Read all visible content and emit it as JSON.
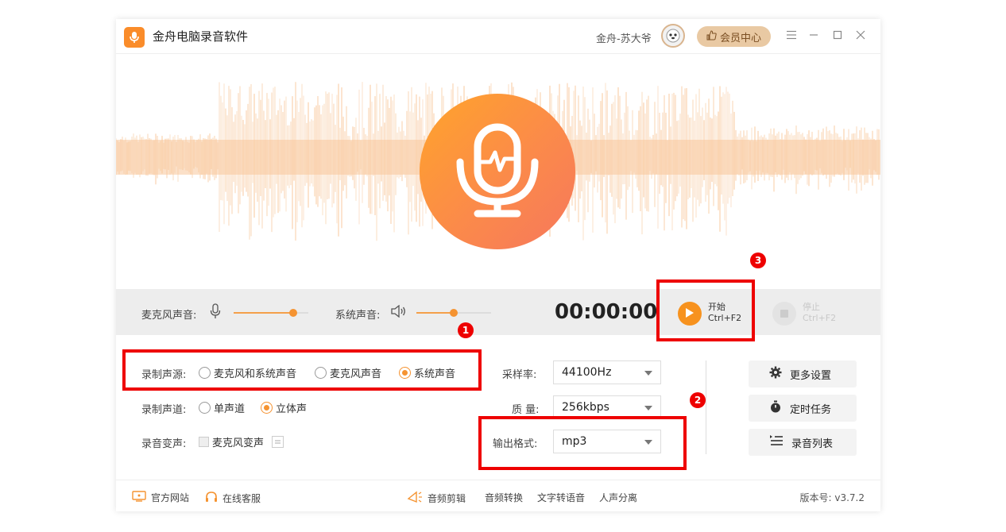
{
  "app": {
    "title": "金舟电脑录音软件",
    "user": "金舟-苏大爷",
    "vip_label": "会员中心"
  },
  "controls": {
    "mic_label": "麦克风声音:",
    "mic_volume": 0.8,
    "system_label": "系统声音:",
    "system_volume": 0.5,
    "timer": "00:00:00",
    "start_label": "开始",
    "start_shortcut": "Ctrl+F2",
    "stop_label": "停止",
    "stop_shortcut": "Ctrl+F2"
  },
  "settings": {
    "source_label": "录制声源:",
    "source_options": [
      "麦克风和系统声音",
      "麦克风声音",
      "系统声音"
    ],
    "source_selected": "系统声音",
    "channel_label": "录制声道:",
    "channel_options": [
      "单声道",
      "立体声"
    ],
    "channel_selected": "立体声",
    "voice_change_label": "录音变声:",
    "voice_change_option": "麦克风变声",
    "sample_rate_label": "采样率:",
    "sample_rate": "44100Hz",
    "quality_label": "质 量:",
    "quality": "256kbps",
    "format_label": "输出格式:",
    "format": "mp3"
  },
  "side_buttons": {
    "more_settings": "更多设置",
    "scheduled_task": "定时任务",
    "record_list": "录音列表"
  },
  "annotations": {
    "badge1": "1",
    "badge2": "2",
    "badge3": "3"
  },
  "footer": {
    "website": "官方网站",
    "support": "在线客服",
    "audio_edit": "音频剪辑",
    "audio_convert": "音频转换",
    "text_to_speech": "文字转语音",
    "vocal_separate": "人声分离",
    "version": "版本号: v3.7.2"
  },
  "colors": {
    "accent": "#f59331",
    "highlight": "#e00000",
    "wave": "#f8c79a"
  }
}
